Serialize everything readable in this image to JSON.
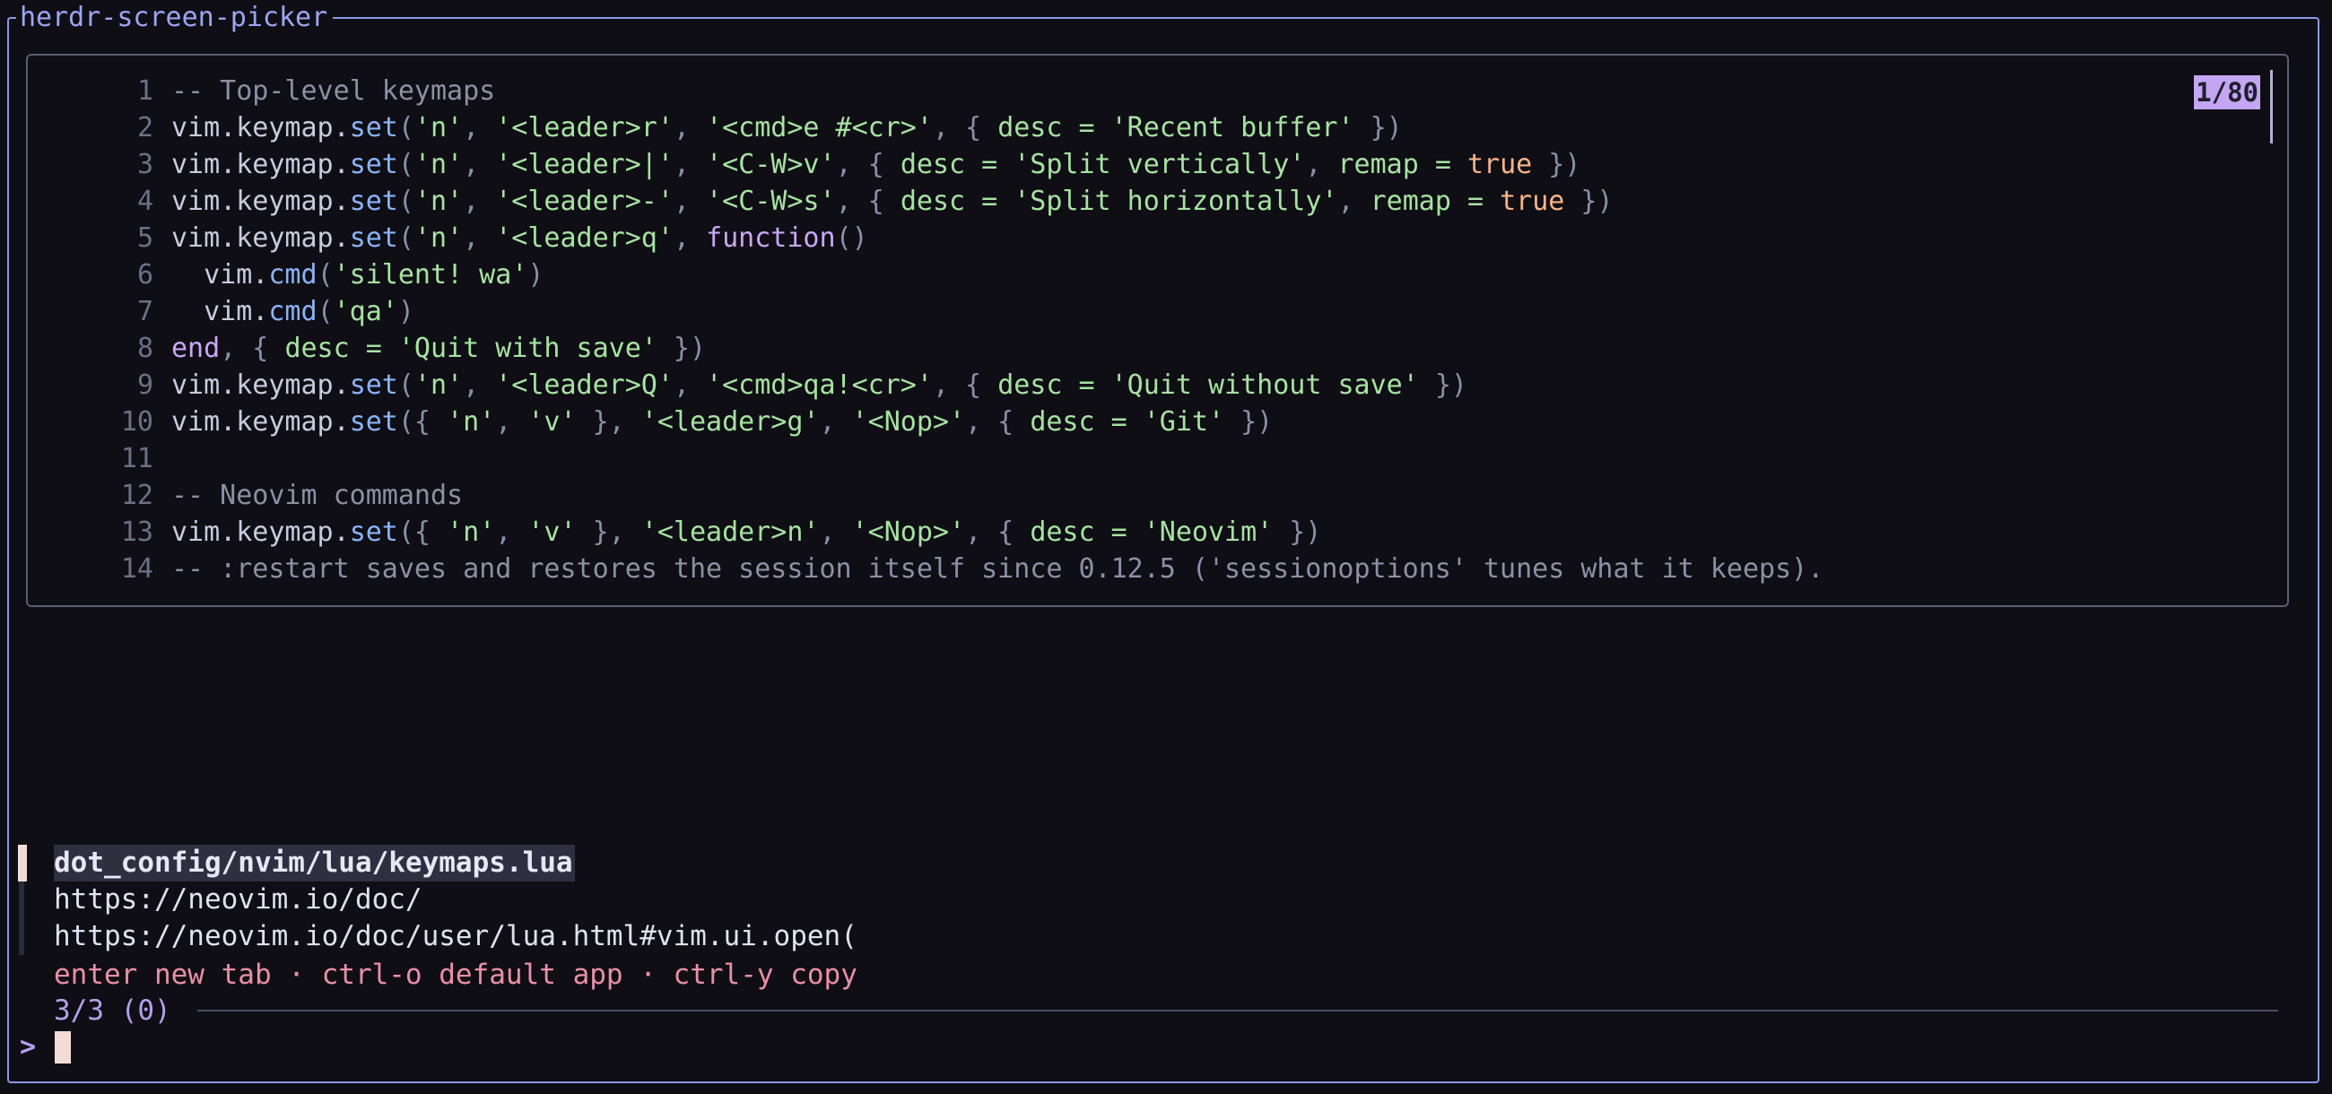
{
  "window": {
    "title": "herdr-screen-picker"
  },
  "preview": {
    "position_badge": "1/80",
    "lines": [
      {
        "n": "1",
        "tokens": [
          [
            "com",
            "-- Top-level keymaps"
          ]
        ]
      },
      {
        "n": "2",
        "tokens": [
          [
            "plain",
            "vim.keymap."
          ],
          [
            "fn",
            "set"
          ],
          [
            "punc",
            "("
          ],
          [
            "str",
            "'n'"
          ],
          [
            "punc",
            ", "
          ],
          [
            "str",
            "'<leader>r'"
          ],
          [
            "punc",
            ", "
          ],
          [
            "str",
            "'<cmd>e #<cr>'"
          ],
          [
            "punc",
            ", { "
          ],
          [
            "str",
            "desc = 'Recent buffer'"
          ],
          [
            "punc",
            " })"
          ]
        ]
      },
      {
        "n": "3",
        "tokens": [
          [
            "plain",
            "vim.keymap."
          ],
          [
            "fn",
            "set"
          ],
          [
            "punc",
            "("
          ],
          [
            "str",
            "'n'"
          ],
          [
            "punc",
            ", "
          ],
          [
            "str",
            "'<leader>|'"
          ],
          [
            "punc",
            ", "
          ],
          [
            "str",
            "'<C-W>v'"
          ],
          [
            "punc",
            ", { "
          ],
          [
            "str",
            "desc = 'Split vertically'"
          ],
          [
            "punc",
            ", "
          ],
          [
            "str",
            "remap = "
          ],
          [
            "bool",
            "true"
          ],
          [
            "punc",
            " })"
          ]
        ]
      },
      {
        "n": "4",
        "tokens": [
          [
            "plain",
            "vim.keymap."
          ],
          [
            "fn",
            "set"
          ],
          [
            "punc",
            "("
          ],
          [
            "str",
            "'n'"
          ],
          [
            "punc",
            ", "
          ],
          [
            "str",
            "'<leader>-'"
          ],
          [
            "punc",
            ", "
          ],
          [
            "str",
            "'<C-W>s'"
          ],
          [
            "punc",
            ", { "
          ],
          [
            "str",
            "desc = 'Split horizontally'"
          ],
          [
            "punc",
            ", "
          ],
          [
            "str",
            "remap = "
          ],
          [
            "bool",
            "true"
          ],
          [
            "punc",
            " })"
          ]
        ]
      },
      {
        "n": "5",
        "tokens": [
          [
            "plain",
            "vim.keymap."
          ],
          [
            "fn",
            "set"
          ],
          [
            "punc",
            "("
          ],
          [
            "str",
            "'n'"
          ],
          [
            "punc",
            ", "
          ],
          [
            "str",
            "'<leader>q'"
          ],
          [
            "punc",
            ", "
          ],
          [
            "kw",
            "function"
          ],
          [
            "punc",
            "()"
          ]
        ]
      },
      {
        "n": "6",
        "tokens": [
          [
            "plain",
            "  vim."
          ],
          [
            "fn",
            "cmd"
          ],
          [
            "punc",
            "("
          ],
          [
            "str",
            "'silent! wa'"
          ],
          [
            "punc",
            ")"
          ]
        ]
      },
      {
        "n": "7",
        "tokens": [
          [
            "plain",
            "  vim."
          ],
          [
            "fn",
            "cmd"
          ],
          [
            "punc",
            "("
          ],
          [
            "str",
            "'qa'"
          ],
          [
            "punc",
            ")"
          ]
        ]
      },
      {
        "n": "8",
        "tokens": [
          [
            "kw",
            "end"
          ],
          [
            "punc",
            ", { "
          ],
          [
            "str",
            "desc = 'Quit with save'"
          ],
          [
            "punc",
            " })"
          ]
        ]
      },
      {
        "n": "9",
        "tokens": [
          [
            "plain",
            "vim.keymap."
          ],
          [
            "fn",
            "set"
          ],
          [
            "punc",
            "("
          ],
          [
            "str",
            "'n'"
          ],
          [
            "punc",
            ", "
          ],
          [
            "str",
            "'<leader>Q'"
          ],
          [
            "punc",
            ", "
          ],
          [
            "str",
            "'<cmd>qa!<cr>'"
          ],
          [
            "punc",
            ", { "
          ],
          [
            "str",
            "desc = 'Quit without save'"
          ],
          [
            "punc",
            " })"
          ]
        ]
      },
      {
        "n": "10",
        "tokens": [
          [
            "plain",
            "vim.keymap."
          ],
          [
            "fn",
            "set"
          ],
          [
            "punc",
            "({ "
          ],
          [
            "str",
            "'n'"
          ],
          [
            "punc",
            ", "
          ],
          [
            "str",
            "'v'"
          ],
          [
            "punc",
            " }, "
          ],
          [
            "str",
            "'<leader>g'"
          ],
          [
            "punc",
            ", "
          ],
          [
            "str",
            "'<Nop>'"
          ],
          [
            "punc",
            ", { "
          ],
          [
            "str",
            "desc = 'Git'"
          ],
          [
            "punc",
            " })"
          ]
        ]
      },
      {
        "n": "11",
        "tokens": []
      },
      {
        "n": "12",
        "tokens": [
          [
            "com",
            "-- Neovim commands"
          ]
        ]
      },
      {
        "n": "13",
        "tokens": [
          [
            "plain",
            "vim.keymap."
          ],
          [
            "fn",
            "set"
          ],
          [
            "punc",
            "({ "
          ],
          [
            "str",
            "'n'"
          ],
          [
            "punc",
            ", "
          ],
          [
            "str",
            "'v'"
          ],
          [
            "punc",
            " }, "
          ],
          [
            "str",
            "'<leader>n'"
          ],
          [
            "punc",
            ", "
          ],
          [
            "str",
            "'<Nop>'"
          ],
          [
            "punc",
            ", { "
          ],
          [
            "str",
            "desc = 'Neovim'"
          ],
          [
            "punc",
            " })"
          ]
        ]
      },
      {
        "n": "14",
        "tokens": [
          [
            "com",
            "-- :restart saves and restores the session itself since 0.12.5 ('sessionoptions' tunes what it keeps)."
          ]
        ]
      }
    ]
  },
  "results": [
    {
      "label": "dot_config/nvim/lua/keymaps.lua",
      "selected": true
    },
    {
      "label": "https://neovim.io/doc/",
      "selected": false
    },
    {
      "label": "https://neovim.io/doc/user/lua.html#vim.ui.open(",
      "selected": false
    }
  ],
  "hints": {
    "text": "enter new tab · ctrl-o default app · ctrl-y copy"
  },
  "counter": {
    "text": "3/3 (0)"
  },
  "prompt": {
    "symbol": ">",
    "value": ""
  },
  "colors": {
    "frame_border": "#8b97e6",
    "preview_border": "#5a5e72",
    "badge_bg": "#c4a6f4",
    "hint": "#eb8ea6",
    "counter": "#b4a0ec",
    "cursor": "#f2ddd6"
  }
}
